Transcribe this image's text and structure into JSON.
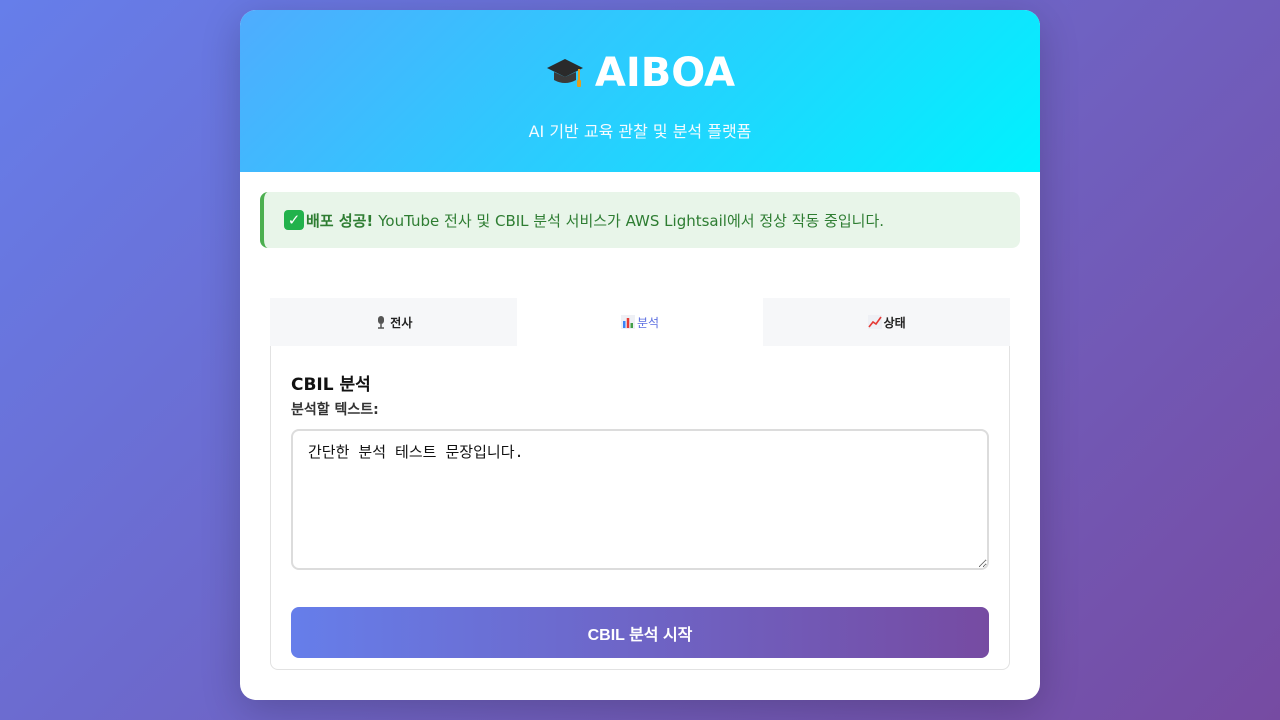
{
  "header": {
    "title": "AIBOA",
    "subtitle": "AI 기반 교육 관찰 및 분석 플랫폼",
    "icon": "graduation-cap-icon"
  },
  "alert": {
    "icon": "check-icon",
    "strong": "배포 성공!",
    "message": "YouTube 전사 및 CBIL 분석 서비스가 AWS Lightsail에서 정상 작동 중입니다."
  },
  "tabs": [
    {
      "label": "전사",
      "icon": "microphone-icon",
      "active": false
    },
    {
      "label": "분석",
      "icon": "bar-chart-icon",
      "active": true
    },
    {
      "label": "상태",
      "icon": "line-chart-icon",
      "active": false
    }
  ],
  "panel": {
    "title": "CBIL 분석",
    "field_label": "분석할 텍스트:",
    "textarea_value": "간단한 분석 테스트 문장입니다.",
    "submit_label": "CBIL 분석 시작"
  },
  "colors": {
    "header_gradient_start": "#4facfe",
    "header_gradient_end": "#00f2fe",
    "accent": "#667eea",
    "accent_end": "#764ba2",
    "success_bg": "#e8f5e9",
    "success_text": "#2e7d32"
  }
}
